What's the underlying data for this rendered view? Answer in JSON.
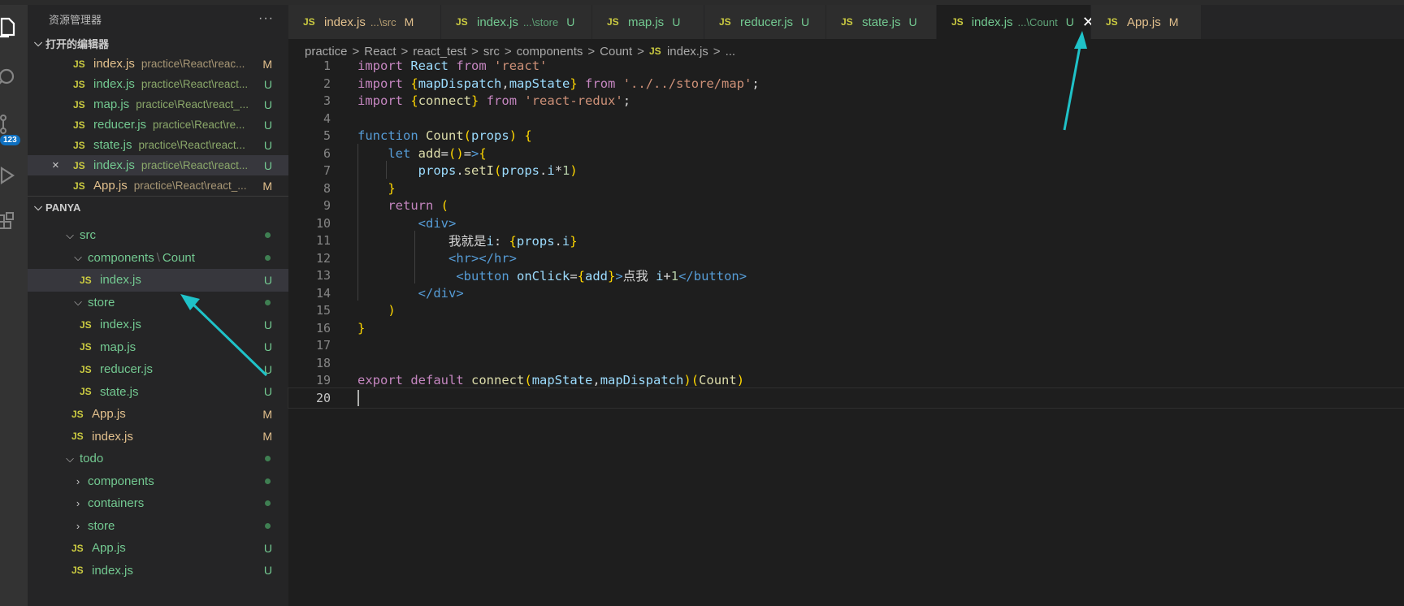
{
  "explorer": {
    "title": "资源管理器",
    "more": "···",
    "open_editors_label": "打开的编辑器",
    "open_editors": [
      {
        "name": "index.js",
        "path": "practice\\React\\reac...",
        "status": "M"
      },
      {
        "name": "index.js",
        "path": "practice\\React\\react...",
        "status": "U"
      },
      {
        "name": "map.js",
        "path": "practice\\React\\react_...",
        "status": "U"
      },
      {
        "name": "reducer.js",
        "path": "practice\\React\\re...",
        "status": "U"
      },
      {
        "name": "state.js",
        "path": "practice\\React\\react...",
        "status": "U"
      },
      {
        "name": "index.js",
        "path": "practice\\React\\react...",
        "status": "U"
      },
      {
        "name": "App.js",
        "path": "practice\\React\\react_...",
        "status": "M"
      }
    ],
    "close_glyph": "×",
    "folder_label": "PANYA",
    "tree": {
      "src": "src",
      "components": "components",
      "components_sep": "\\",
      "count": "Count",
      "count_index": {
        "name": "index.js",
        "status": "U"
      },
      "store": "store",
      "store_files": [
        {
          "name": "index.js",
          "status": "U"
        },
        {
          "name": "map.js",
          "status": "U"
        },
        {
          "name": "reducer.js",
          "status": "U"
        },
        {
          "name": "state.js",
          "status": "U"
        }
      ],
      "src_files": [
        {
          "name": "App.js",
          "status": "M"
        },
        {
          "name": "index.js",
          "status": "M"
        }
      ],
      "todo": "todo",
      "todo_folders": [
        "components",
        "containers",
        "store"
      ],
      "todo_files": [
        {
          "name": "App.js",
          "status": "U"
        },
        {
          "name": "index.js",
          "status": "U"
        }
      ]
    }
  },
  "activity_badge": "123",
  "file_icon_label": "JS",
  "tabs": [
    {
      "name": "index.js",
      "desc": "...\\src",
      "status": "M"
    },
    {
      "name": "index.js",
      "desc": "...\\store",
      "status": "U"
    },
    {
      "name": "map.js",
      "desc": "",
      "status": "U"
    },
    {
      "name": "reducer.js",
      "desc": "",
      "status": "U"
    },
    {
      "name": "state.js",
      "desc": "",
      "status": "U"
    },
    {
      "name": "index.js",
      "desc": "...\\Count",
      "status": "U",
      "close": "✕"
    },
    {
      "name": "App.js",
      "desc": "",
      "status": "M"
    }
  ],
  "breadcrumb": [
    "practice",
    "React",
    "react_test",
    "src",
    "components",
    "Count",
    "index.js",
    "..."
  ],
  "breadcrumb_sep": ">",
  "code_lines": [
    "import React from 'react'",
    "import {mapDispatch,mapState} from '../../store/map';",
    "import {connect} from 'react-redux';",
    "",
    "function Count(props) {",
    "    let add=()=>{",
    "        props.setI(props.i*1)",
    "    }",
    "    return (",
    "        <div>",
    "            我就是i: {props.i}",
    "            <hr></hr>",
    "             <button onClick={add}>点我 i+1</button>",
    "        </div>",
    "    )",
    "}",
    "",
    "",
    "export default connect(mapState,mapDispatch)(Count)",
    ""
  ],
  "current_line": 20,
  "colors": {
    "accent_arrow": "#1fc2c8",
    "untracked": "#73c991",
    "modified": "#e2c08d"
  }
}
